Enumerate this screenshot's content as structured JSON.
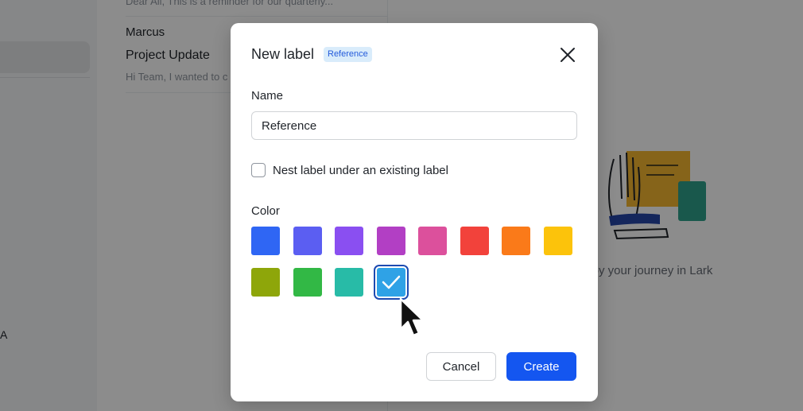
{
  "background": {
    "list": {
      "preview_top": "Dear All, This is a reminder for our quarterly...",
      "sender": "Marcus",
      "subject": "Project Update",
      "preview": "Hi Team, I wanted to c"
    },
    "sidebar_fragment": "A",
    "empty_state": {
      "tagline": "njoy your journey in Lark",
      "illustration": "hand-note-illustration"
    }
  },
  "dialog": {
    "title": "New label",
    "badge": "Reference",
    "close_icon": "close-icon",
    "name_label": "Name",
    "name_value": "Reference",
    "nest_checked": false,
    "nest_label": "Nest label under an existing label",
    "color_label": "Color",
    "colors": [
      {
        "name": "blue",
        "hex": "#2f66f4"
      },
      {
        "name": "indigo",
        "hex": "#5b5ef2"
      },
      {
        "name": "violet",
        "hex": "#8a4ff1"
      },
      {
        "name": "purple",
        "hex": "#b23fc4"
      },
      {
        "name": "pink",
        "hex": "#dc509c"
      },
      {
        "name": "red",
        "hex": "#f2423b"
      },
      {
        "name": "orange",
        "hex": "#fa7a19"
      },
      {
        "name": "yellow",
        "hex": "#fcc30b"
      },
      {
        "name": "olive",
        "hex": "#8ea60a"
      },
      {
        "name": "green",
        "hex": "#32b845"
      },
      {
        "name": "teal",
        "hex": "#28bba7"
      },
      {
        "name": "light-blue",
        "hex": "#2fa2e6"
      }
    ],
    "selected_color": "light-blue",
    "cancel_label": "Cancel",
    "create_label": "Create",
    "accent": "#1456f0"
  }
}
